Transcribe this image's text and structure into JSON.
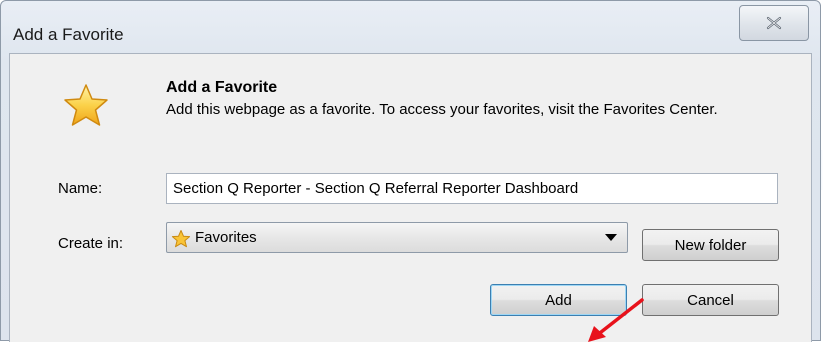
{
  "window": {
    "title": "Add a Favorite",
    "close_icon": "close-icon"
  },
  "dialog": {
    "icon": "star-icon",
    "heading": "Add a Favorite",
    "description": "Add this webpage as a favorite. To access your favorites, visit the Favorites Center.",
    "name_label": "Name:",
    "name_value": "Section Q Reporter - Section Q Referral Reporter Dashboard",
    "create_in_label": "Create in:",
    "create_in_value": "Favorites",
    "create_in_icon": "star-icon",
    "new_folder_label": "New folder",
    "add_label": "Add",
    "cancel_label": "Cancel"
  },
  "annotation": {
    "arrow_icon": "red-arrow-icon",
    "arrow_color": "#e8121b"
  },
  "colors": {
    "star_fill": "#f9c437",
    "title_bar": "#dfe6ef",
    "client_bg": "#f0f0f0"
  }
}
